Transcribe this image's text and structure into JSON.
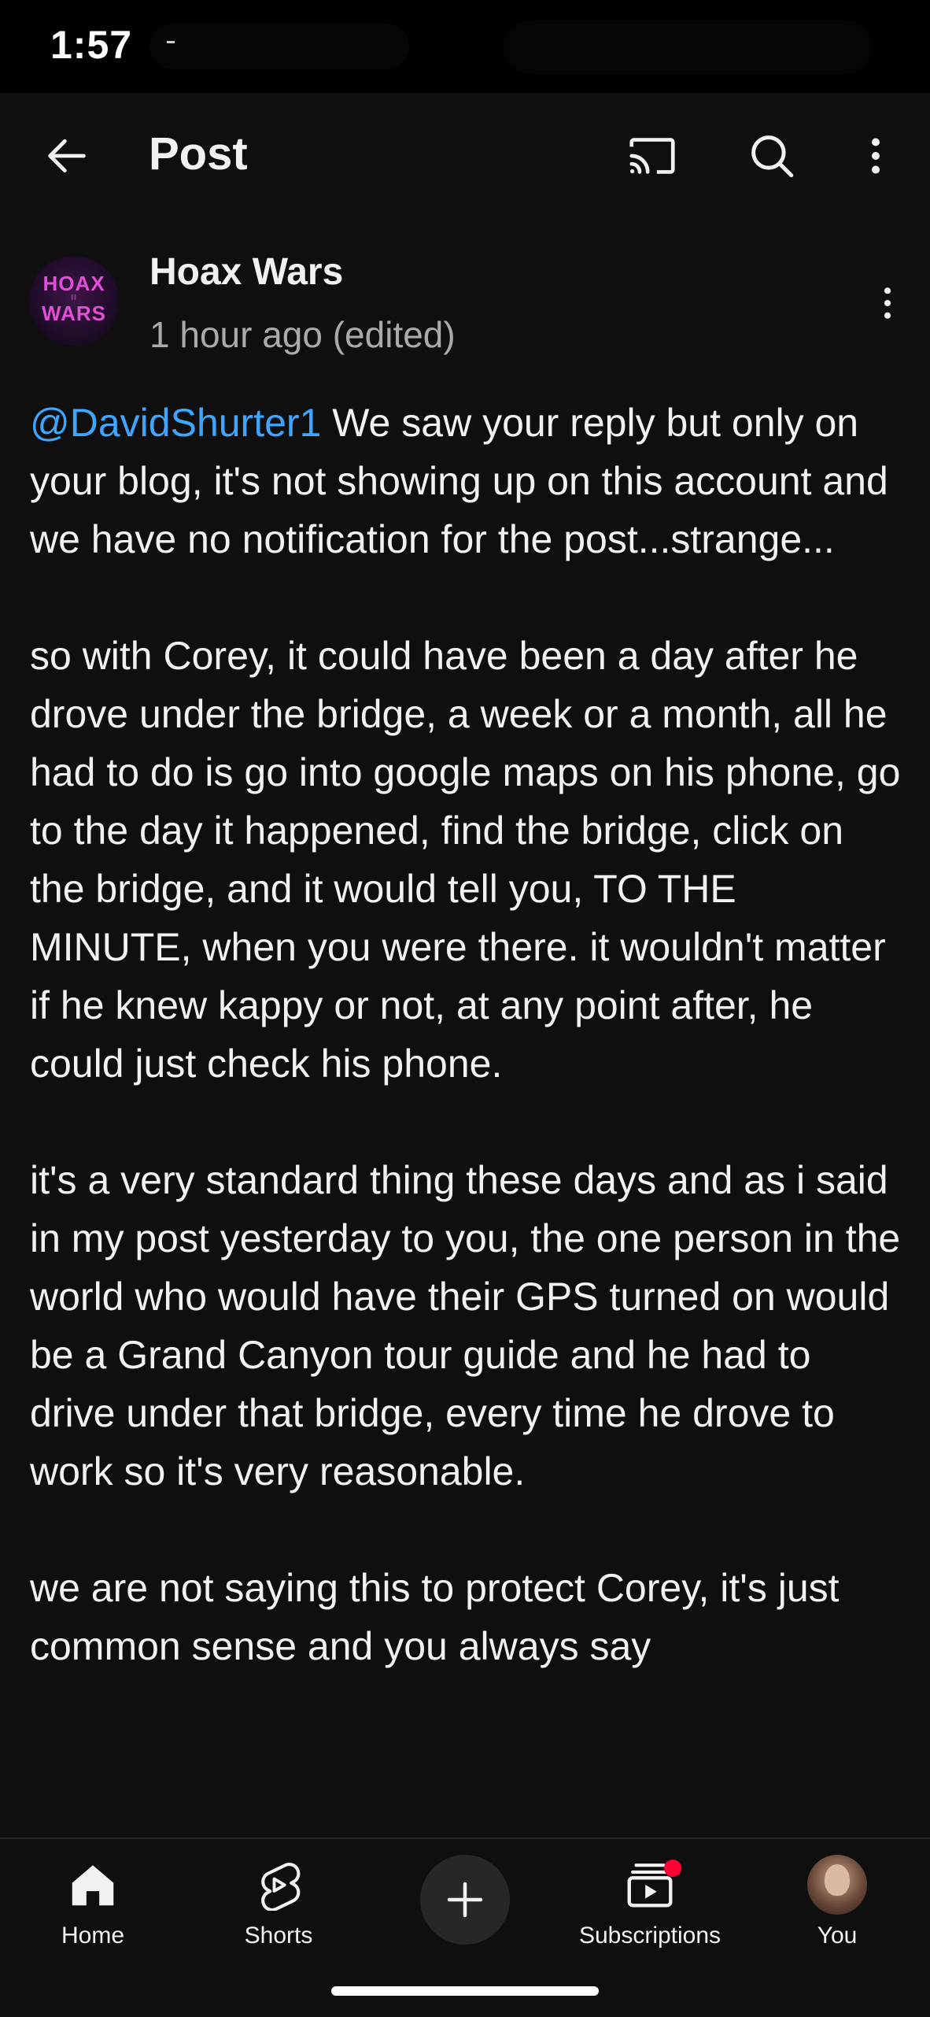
{
  "status_bar": {
    "time": "1:57",
    "dash": "-"
  },
  "header": {
    "title": "Post",
    "back_icon": "arrow-left-icon",
    "cast_icon": "cast-icon",
    "search_icon": "search-icon",
    "more_icon": "more-vertical-icon"
  },
  "post": {
    "avatar_text_line1": "HOAX",
    "avatar_text_line2": "WARS",
    "channel_name": "Hoax Wars",
    "time": "1 hour ago (edited)",
    "mention": "@DavidShurter1",
    "paragraphs": [
      " We saw your reply but only on your blog, it's not showing up on this account and we have no notification for the post...strange...",
      "so with Corey, it could have been a day after he drove under the bridge, a week or a month, all he had to do is go into google maps on his phone, go to the day it happened, find the bridge, click on the bridge, and it would tell you, TO THE MINUTE, when you were there. it wouldn't matter if he knew kappy or not, at any point after, he could just check his phone.",
      "it's a very standard thing these days and as i said in my post yesterday to you, the one person in the world who would have their GPS turned on would be a Grand Canyon tour guide and he had to drive under that bridge, every time he drove to work so it's very reasonable.",
      "we are not saying this to protect Corey, it's just common sense and you always say"
    ]
  },
  "bottom_nav": {
    "home": "Home",
    "shorts": "Shorts",
    "create_icon": "plus-icon",
    "subscriptions": "Subscriptions",
    "you": "You"
  },
  "colors": {
    "background": "#0f0f0f",
    "mention": "#3ea6ff",
    "secondary_text": "#aaaaaa",
    "notification_dot": "#ff0033"
  }
}
